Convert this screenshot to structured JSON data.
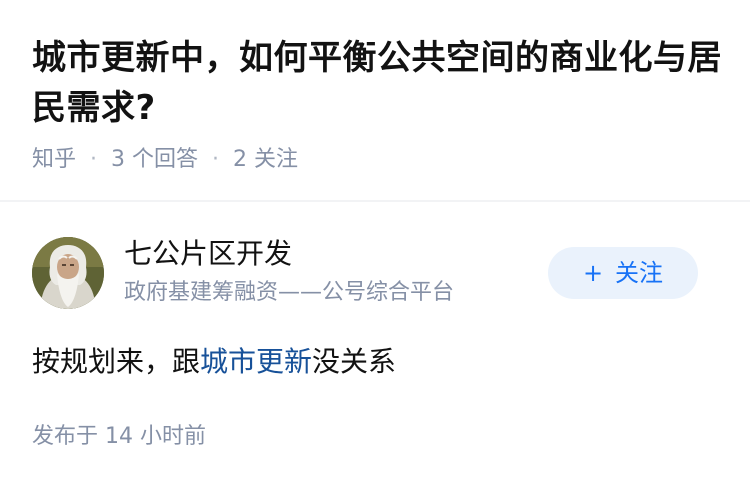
{
  "question": {
    "title": "城市更新中，如何平衡公共空间的商业化与居民需求?",
    "meta": {
      "site": "知乎",
      "answers": "3 个回答",
      "followers": "2 关注",
      "separator": "·"
    }
  },
  "answer": {
    "author": {
      "name": "七公片区开发",
      "bio": "政府基建筹融资——公号综合平台"
    },
    "follow_button": {
      "icon": "+",
      "label": "关注"
    },
    "body": {
      "prefix": "按规划来，跟",
      "link": "城市更新",
      "suffix": "没关系"
    },
    "published": "发布于 14 小时前"
  },
  "colors": {
    "title": "#121212",
    "meta": "#8590a6",
    "link": "#175199",
    "follow_bg": "#eaf2fc",
    "follow_text": "#1772f6"
  }
}
